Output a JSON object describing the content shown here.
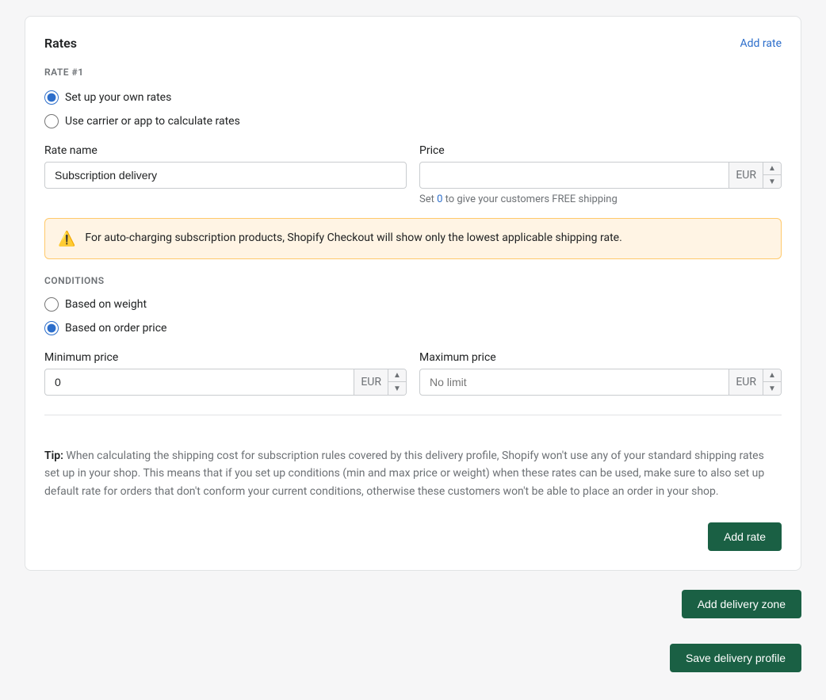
{
  "card": {
    "title": "Rates",
    "add_rate_link": "Add rate",
    "rate_label": "RATE #1",
    "radio_options": [
      {
        "id": "own-rates",
        "label": "Set up your own rates",
        "checked": true
      },
      {
        "id": "carrier-rates",
        "label": "Use carrier or app to calculate rates",
        "checked": false
      }
    ],
    "rate_name_label": "Rate name",
    "rate_name_value": "Subscription delivery",
    "price_label": "Price",
    "price_value": "",
    "price_currency": "EUR",
    "free_shipping_hint": "Set 0 to give your customers FREE shipping",
    "free_shipping_link_text": "0",
    "alert_text": "For auto-charging subscription products, Shopify Checkout will show only the lowest applicable shipping rate.",
    "conditions_label": "CONDITIONS",
    "condition_options": [
      {
        "id": "based-on-weight",
        "label": "Based on weight",
        "checked": false
      },
      {
        "id": "based-on-order-price",
        "label": "Based on order price",
        "checked": true
      }
    ],
    "min_price_label": "Minimum price",
    "min_price_value": "0",
    "min_price_currency": "EUR",
    "max_price_label": "Maximum price",
    "max_price_value": "",
    "max_price_placeholder": "No limit",
    "max_price_currency": "EUR",
    "tip_strong": "Tip:",
    "tip_text": " When calculating the shipping cost for subscription rules covered by this delivery profile, Shopify won't use any of your standard shipping rates set up in your shop. This means that if you set up conditions (min and max price or weight) when these rates can be used, make sure to also set up default rate for orders that don't conform your current conditions, otherwise these customers won't be able to place an order in your shop.",
    "add_rate_button": "Add rate"
  },
  "bottom_bar": {
    "add_delivery_zone_button": "Add delivery zone",
    "save_profile_button": "Save delivery profile"
  }
}
